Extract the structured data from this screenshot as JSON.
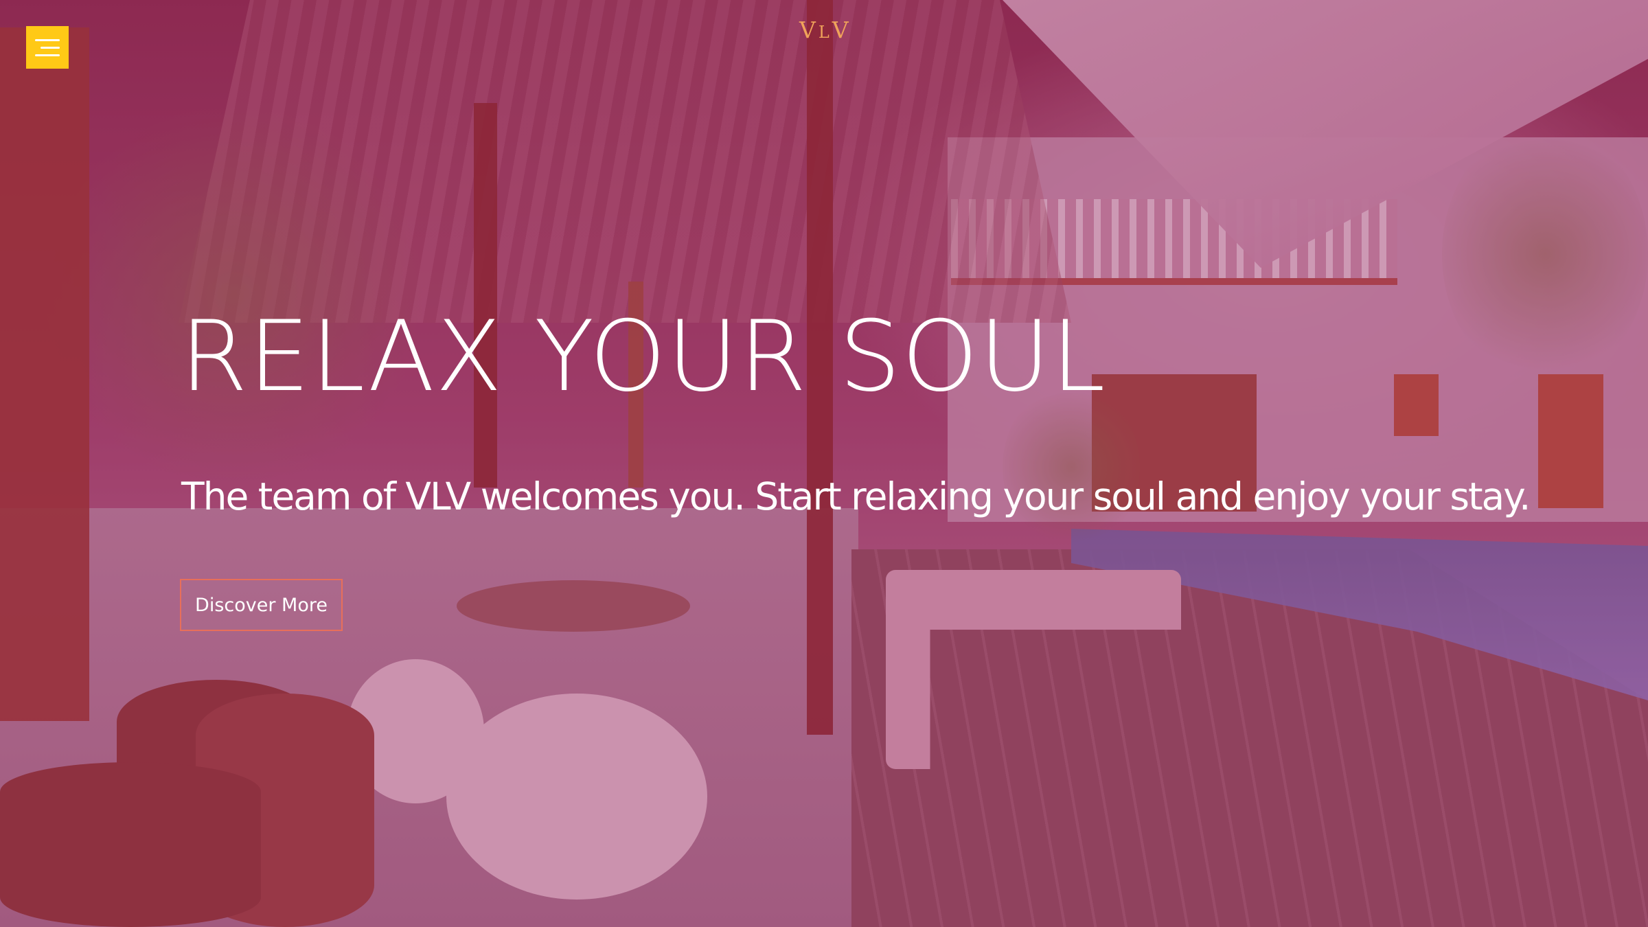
{
  "header": {
    "menu_icon": "hamburger-icon",
    "logo": {
      "first": "V",
      "middle": "L",
      "last": "V"
    }
  },
  "hero": {
    "title": "RELAX YOUR SOUL",
    "subtitle": "The team of VLV welcomes you. Start relaxing your soul and enjoy your stay.",
    "cta_label": "Discover More"
  },
  "colors": {
    "menu_button": "#ffc916",
    "logo": "#f0a35a",
    "cta_border": "#e86f5a",
    "overlay": "#961e5a"
  }
}
